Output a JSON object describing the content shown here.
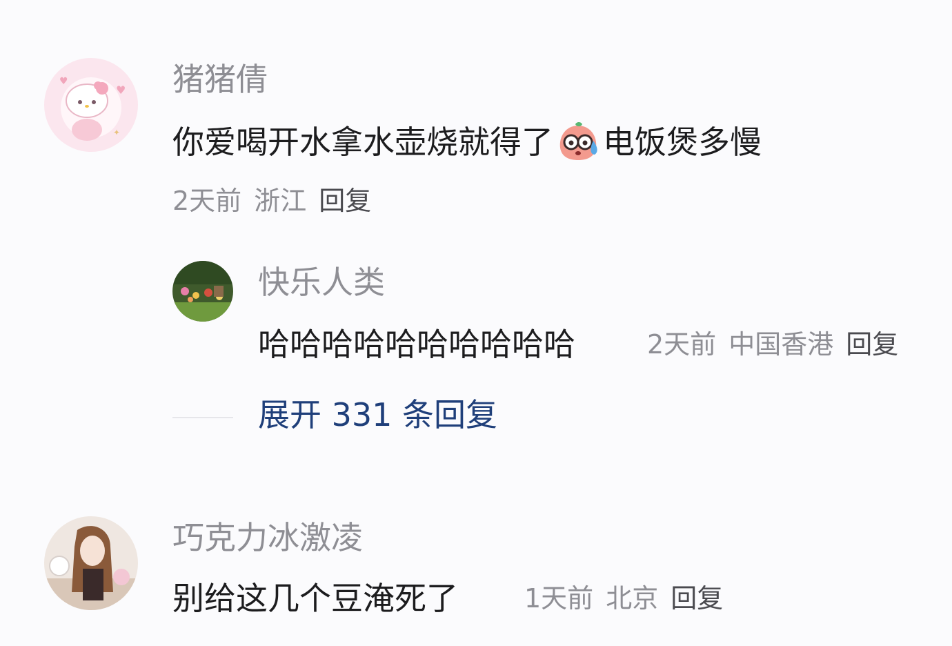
{
  "comments": [
    {
      "username": "猪猪倩",
      "text_before": "你爱喝开水拿水壶烧就得了",
      "emoji": "sweat-face-emoji",
      "text_after": "电饭煲多慢",
      "time": "2天前",
      "location": "浙江",
      "reply": "回复"
    },
    {
      "username": "巧克力冰激凌",
      "text": "别给这几个豆淹死了",
      "time": "1天前",
      "location": "北京",
      "reply": "回复"
    }
  ],
  "sub_reply": {
    "username": "快乐人类",
    "text": "哈哈哈哈哈哈哈哈哈哈",
    "time": "2天前",
    "location": "中国香港",
    "reply": "回复"
  },
  "expand_replies": "展开 331 条回复",
  "colors": {
    "background": "#fbfbfd",
    "username": "#8e8e94",
    "text": "#1c1c1e",
    "expand": "#1f3f7a"
  }
}
